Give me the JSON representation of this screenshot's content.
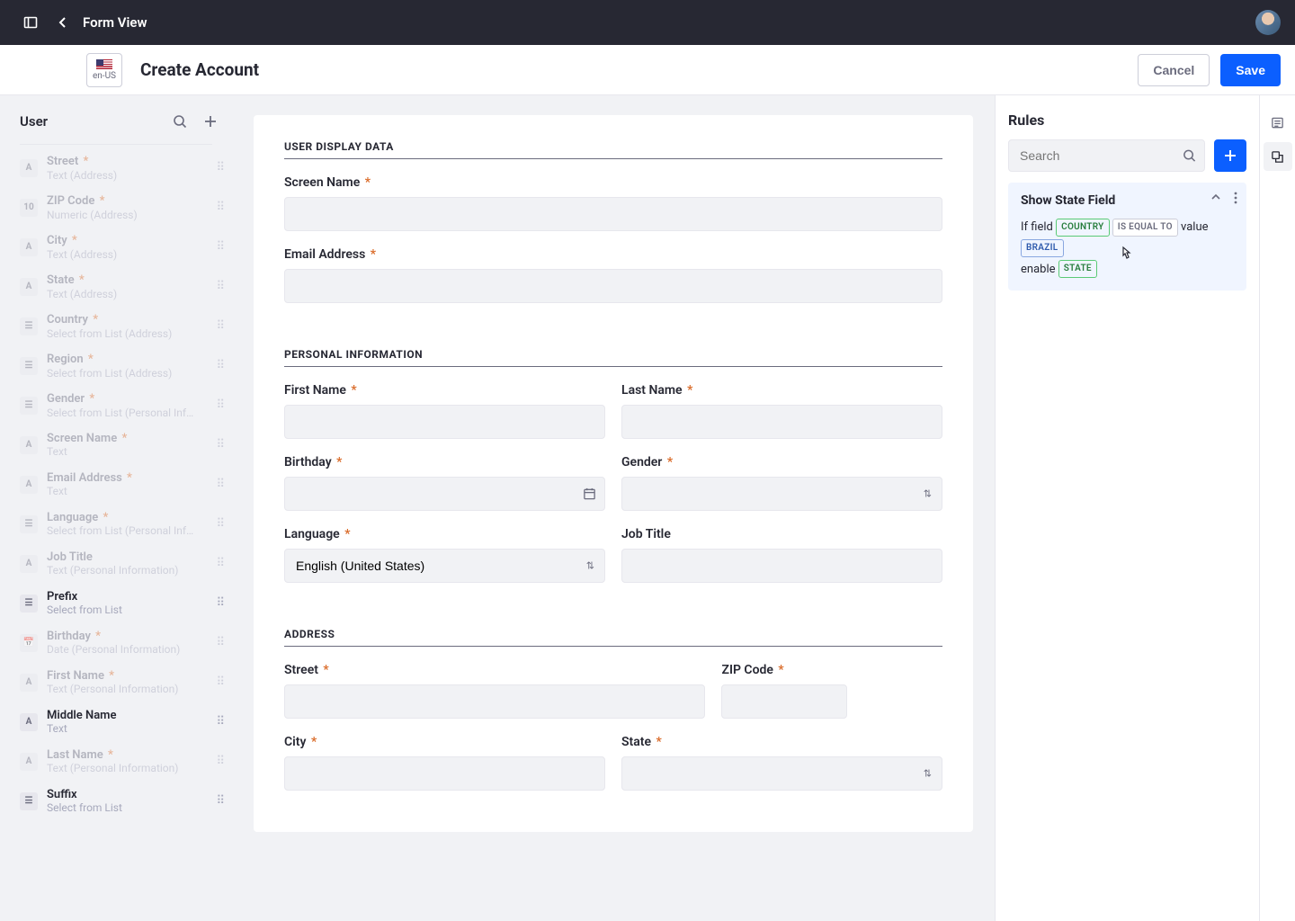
{
  "topbar": {
    "title": "Form View"
  },
  "subheader": {
    "locale": "en-US",
    "page_title": "Create Account",
    "cancel": "Cancel",
    "save": "Save"
  },
  "sidebar": {
    "title": "User",
    "fields": [
      {
        "icon": "A",
        "name": "Street",
        "req": true,
        "sub": "Text (Address)",
        "dim": true
      },
      {
        "icon": "10",
        "name": "ZIP Code",
        "req": true,
        "sub": "Numeric (Address)",
        "dim": true
      },
      {
        "icon": "A",
        "name": "City",
        "req": true,
        "sub": "Text (Address)",
        "dim": true
      },
      {
        "icon": "A",
        "name": "State",
        "req": true,
        "sub": "Text (Address)",
        "dim": true
      },
      {
        "icon": "☰",
        "name": "Country",
        "req": true,
        "sub": "Select from List (Address)",
        "dim": true
      },
      {
        "icon": "☰",
        "name": "Region",
        "req": true,
        "sub": "Select from List (Address)",
        "dim": true
      },
      {
        "icon": "☰",
        "name": "Gender",
        "req": true,
        "sub": "Select from List (Personal Inf…",
        "dim": true
      },
      {
        "icon": "A",
        "name": "Screen Name",
        "req": true,
        "sub": "Text",
        "dim": true
      },
      {
        "icon": "A",
        "name": "Email Address",
        "req": true,
        "sub": "Text",
        "dim": true
      },
      {
        "icon": "☰",
        "name": "Language",
        "req": true,
        "sub": "Select from List (Personal Inf…",
        "dim": true
      },
      {
        "icon": "A",
        "name": "Job Title",
        "req": false,
        "sub": "Text (Personal Information)",
        "dim": true
      },
      {
        "icon": "☰",
        "name": "Prefix",
        "req": false,
        "sub": "Select from List",
        "dim": false
      },
      {
        "icon": "📅",
        "name": "Birthday",
        "req": true,
        "sub": "Date (Personal Information)",
        "dim": true
      },
      {
        "icon": "A",
        "name": "First Name",
        "req": true,
        "sub": "Text (Personal Information)",
        "dim": true
      },
      {
        "icon": "A",
        "name": "Middle Name",
        "req": false,
        "sub": "Text",
        "dim": false
      },
      {
        "icon": "A",
        "name": "Last Name",
        "req": true,
        "sub": "Text (Personal Information)",
        "dim": true
      },
      {
        "icon": "☰",
        "name": "Suffix",
        "req": false,
        "sub": "Select from List",
        "dim": false
      }
    ]
  },
  "form": {
    "sections": {
      "user_display": "USER DISPLAY DATA",
      "personal": "PERSONAL INFORMATION",
      "address": "ADDRESS"
    },
    "labels": {
      "screen_name": "Screen Name",
      "email": "Email Address",
      "first_name": "First Name",
      "last_name": "Last Name",
      "birthday": "Birthday",
      "gender": "Gender",
      "language": "Language",
      "job_title": "Job Title",
      "street": "Street",
      "zip": "ZIP Code",
      "city": "City",
      "state": "State"
    },
    "values": {
      "language": "English (United States)"
    }
  },
  "rules": {
    "title": "Rules",
    "search_placeholder": "Search",
    "card": {
      "title": "Show State Field",
      "expr": {
        "if_field": "If field",
        "country": "COUNTRY",
        "is_equal": "IS EQUAL TO",
        "value_word": "value",
        "brazil": "BRAZIL",
        "enable": "enable",
        "state": "STATE"
      }
    }
  }
}
